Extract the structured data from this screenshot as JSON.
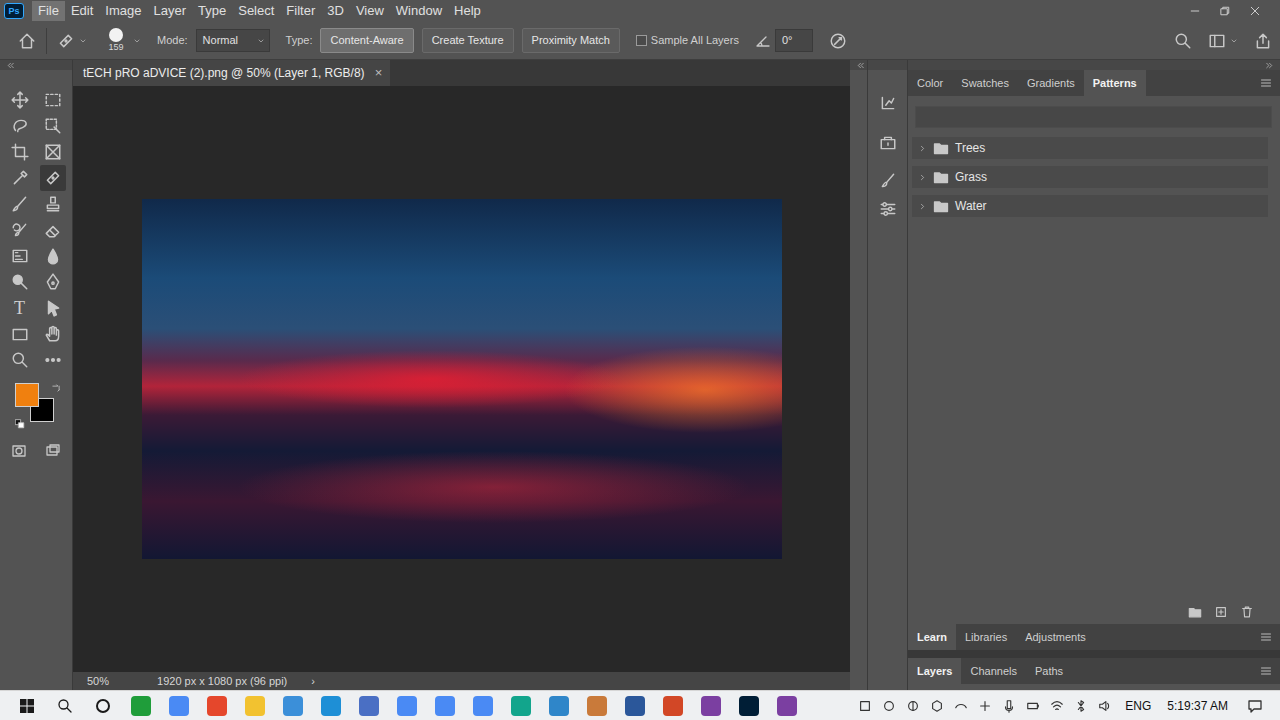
{
  "app": {
    "logo": "Ps"
  },
  "menu": [
    {
      "label": "File",
      "selected": true
    },
    {
      "label": "Edit",
      "selected": false
    },
    {
      "label": "Image",
      "selected": false
    },
    {
      "label": "Layer",
      "selected": false
    },
    {
      "label": "Type",
      "selected": false
    },
    {
      "label": "Select",
      "selected": false
    },
    {
      "label": "Filter",
      "selected": false
    },
    {
      "label": "3D",
      "selected": false
    },
    {
      "label": "View",
      "selected": false
    },
    {
      "label": "Window",
      "selected": false
    },
    {
      "label": "Help",
      "selected": false
    }
  ],
  "options": {
    "brush_size": "159",
    "mode_label": "Mode:",
    "mode": "Normal",
    "type_label": "Type:",
    "types": [
      {
        "label": "Content-Aware",
        "selected": true
      },
      {
        "label": "Create Texture",
        "selected": false
      },
      {
        "label": "Proximity Match",
        "selected": false
      }
    ],
    "sample_all_layers": {
      "label": "Sample All Layers",
      "checked": false
    },
    "angle": "0°"
  },
  "tools": [
    {
      "selected": false
    },
    {
      "selected": false
    },
    {
      "selected": false
    },
    {
      "selected": false
    },
    {
      "selected": false
    },
    {
      "selected": false
    },
    {
      "selected": false
    },
    {
      "selected": true
    },
    {
      "selected": false
    },
    {
      "selected": false
    },
    {
      "selected": false
    },
    {
      "selected": false
    },
    {
      "selected": false
    },
    {
      "selected": false
    },
    {
      "selected": false
    },
    {
      "selected": false
    },
    {
      "glyph": "T",
      "selected": false
    },
    {
      "selected": false
    },
    {
      "selected": false
    },
    {
      "selected": false
    },
    {
      "selected": false
    },
    {
      "selected": false
    }
  ],
  "swatches": {
    "foreground": {
      "color": "#f0800f"
    },
    "background": {
      "color": "#000000"
    }
  },
  "document": {
    "tab": "tECH pRO aDVICE (2).png @ 50% (Layer 1, RGB/8)",
    "close": "×"
  },
  "status_bar": {
    "zoom": "50%",
    "info": "1920 px x 1080 px (96 ppi)",
    "more": "›"
  },
  "panels": {
    "top_tabs": [
      {
        "label": "Color",
        "selected": false
      },
      {
        "label": "Swatches",
        "selected": false
      },
      {
        "label": "Gradients",
        "selected": false
      },
      {
        "label": "Patterns",
        "selected": true
      }
    ],
    "patterns": [
      {
        "label": "Trees",
        "expanded": false
      },
      {
        "label": "Grass",
        "expanded": false
      },
      {
        "label": "Water",
        "expanded": false
      }
    ],
    "middle_tabs": [
      {
        "label": "Learn",
        "selected": true
      },
      {
        "label": "Libraries",
        "selected": false
      },
      {
        "label": "Adjustments",
        "selected": false
      }
    ],
    "bottom_tabs": [
      {
        "label": "Layers",
        "selected": true
      },
      {
        "label": "Channels",
        "selected": false
      },
      {
        "label": "Paths",
        "selected": false
      }
    ]
  },
  "taskbar": {
    "apps": [
      {
        "color": "#1f9d3a"
      },
      {
        "color": "#4a8af4"
      },
      {
        "color": "#e5472c"
      },
      {
        "color": "#f2c230"
      },
      {
        "color": "#3b8fd9"
      },
      {
        "color": "#1e8fd6"
      },
      {
        "color": "#4a6fc4"
      },
      {
        "color": "#4a8af4"
      },
      {
        "color": "#4a8af4"
      },
      {
        "color": "#4a8af4"
      },
      {
        "color": "#12a58c"
      },
      {
        "color": "#2f86c9"
      },
      {
        "color": "#c97a3a"
      },
      {
        "color": "#2b579a"
      },
      {
        "color": "#d24726"
      },
      {
        "color": "#7b3fa1"
      },
      {
        "color": "#001e36"
      },
      {
        "color": "#7b3fa1"
      }
    ],
    "language": "ENG",
    "time": "5:19:37 AM"
  }
}
